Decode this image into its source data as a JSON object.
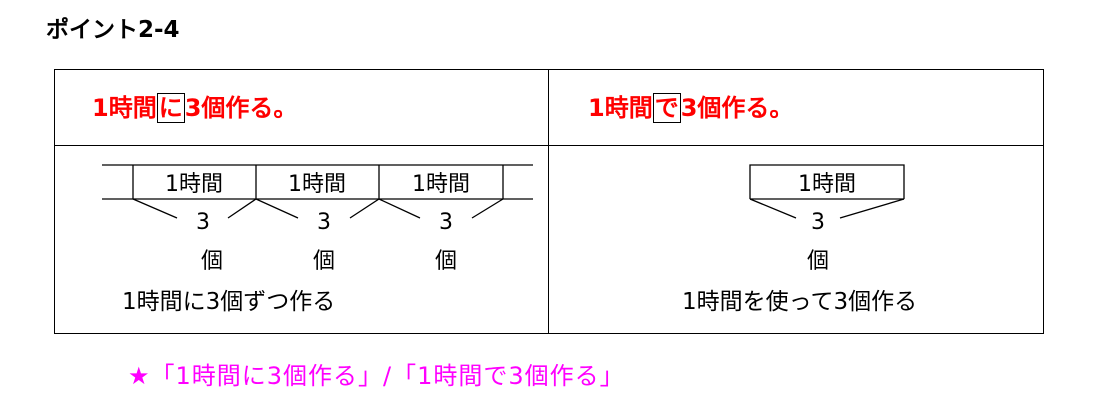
{
  "title": "ポイント2-4",
  "left": {
    "heading_before": "1時間",
    "heading_boxed": "に",
    "heading_after": "3個作る。",
    "cells": [
      "1時間",
      "1時間",
      "1時間"
    ],
    "counts": [
      "3",
      "3",
      "3"
    ],
    "units": [
      "個",
      "個",
      "個"
    ],
    "caption": "1時間に3個ずつ作る"
  },
  "right": {
    "heading_before": "1時間",
    "heading_boxed": "で",
    "heading_after": "3個作る。",
    "cell": "1時間",
    "count": "3",
    "unit": "個",
    "caption": "1時間を使って3個作る"
  },
  "footer": "★「1時間に3個作る」/「1時間で3個作る」",
  "colors": {
    "heading": "#ff0000",
    "footer": "#ff00ff",
    "line": "#000000"
  }
}
